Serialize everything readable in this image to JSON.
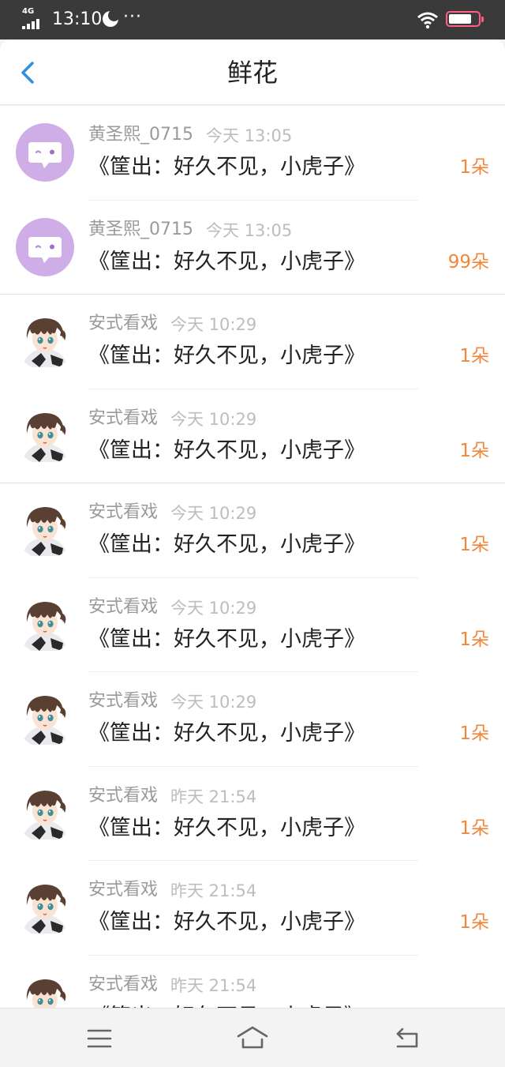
{
  "status_bar": {
    "network": "4G",
    "time": "13:10",
    "dots": "···",
    "icons": [
      "signal-icon",
      "moon-icon",
      "wifi-icon",
      "battery-icon"
    ]
  },
  "header": {
    "title": "鲜花",
    "back_icon": "chevron-left-icon"
  },
  "colors": {
    "accent_back": "#2f8fe0",
    "count_orange": "#f0873b",
    "bubble_avatar": "#cfaee8"
  },
  "rows": [
    {
      "name": "黄圣熙_0715",
      "time": "今天 13:05",
      "title": "《筐出：好久不见，小虎子》",
      "count": "1朵",
      "avatar": "chat-bubble-avatar"
    },
    {
      "name": "黄圣熙_0715",
      "time": "今天 13:05",
      "title": "《筐出：好久不见，小虎子》",
      "count": "99朵",
      "avatar": "chat-bubble-avatar"
    },
    {
      "name": "安式看戏",
      "time": "今天 10:29",
      "title": "《筐出：好久不见，小虎子》",
      "count": "1朵",
      "avatar": "anime-avatar"
    },
    {
      "name": "安式看戏",
      "time": "今天 10:29",
      "title": "《筐出：好久不见，小虎子》",
      "count": "1朵",
      "avatar": "anime-avatar"
    },
    {
      "name": "安式看戏",
      "time": "今天 10:29",
      "title": "《筐出：好久不见，小虎子》",
      "count": "1朵",
      "avatar": "anime-avatar"
    },
    {
      "name": "安式看戏",
      "time": "今天 10:29",
      "title": "《筐出：好久不见，小虎子》",
      "count": "1朵",
      "avatar": "anime-avatar"
    },
    {
      "name": "安式看戏",
      "time": "今天 10:29",
      "title": "《筐出：好久不见，小虎子》",
      "count": "1朵",
      "avatar": "anime-avatar"
    },
    {
      "name": "安式看戏",
      "time": "昨天 21:54",
      "title": "《筐出：好久不见，小虎子》",
      "count": "1朵",
      "avatar": "anime-avatar"
    },
    {
      "name": "安式看戏",
      "time": "昨天 21:54",
      "title": "《筐出：好久不见，小虎子》",
      "count": "1朵",
      "avatar": "anime-avatar"
    },
    {
      "name": "安式看戏",
      "time": "昨天 21:54",
      "title": "《筐出：好久不见，小虎子》",
      "count": "",
      "avatar": "anime-avatar"
    }
  ],
  "nav": {
    "icons": [
      "menu-icon",
      "home-icon",
      "back-icon"
    ]
  }
}
